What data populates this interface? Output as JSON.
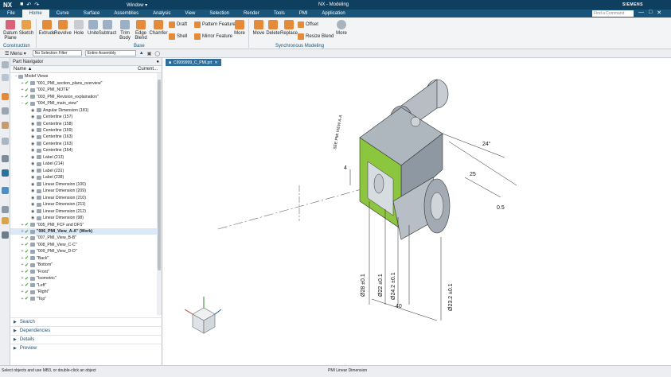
{
  "titlebar": {
    "logo": "NX",
    "window_menu": "Window",
    "title": "NX - Modeling",
    "brand": "SIEMENS",
    "controls": [
      "—",
      "□",
      "✕"
    ]
  },
  "menubar": {
    "tabs": [
      "File",
      "Home",
      "Curve",
      "Surface",
      "Assemblies",
      "Analysis",
      "View",
      "Selection",
      "Render",
      "Tools",
      "PMI",
      "Application"
    ],
    "active_tab": "Home",
    "search_placeholder": "Find a Command"
  },
  "ribbon": {
    "construction": {
      "group_label": "Construction",
      "buttons": [
        "Datum Plane",
        "Sketch"
      ]
    },
    "base": {
      "group_label": "Base",
      "buttons": [
        "Extrude",
        "Revolve",
        "Hole",
        "Unite",
        "Subtract",
        "Trim Body",
        "Edge Blend",
        "Chamfer"
      ],
      "small_buttons": [
        "Draft",
        "Pattern Feature",
        "Shell",
        "Mirror Feature"
      ],
      "more": "More"
    },
    "sync": {
      "group_label": "Synchronous Modeling",
      "buttons": [
        "Move",
        "Delete",
        "Replace"
      ],
      "small_buttons": [
        "Offset",
        "Resize Blend"
      ],
      "more": "More"
    },
    "more_right": "More"
  },
  "toolbar2": {
    "menu_label": "Menu",
    "selection_filter": "No Selection Filter",
    "scope": "Entire Assembly"
  },
  "navigator": {
    "title": "Part Navigator",
    "col_name": "Name",
    "col_current": "Current...",
    "rows": [
      {
        "label": "Model Views",
        "indent": 0,
        "exp": "−",
        "check": false,
        "eye": false
      },
      {
        "label": "\"001_PMI_section_plans_overview\"",
        "indent": 1,
        "exp": "+",
        "check": true,
        "eye": false
      },
      {
        "label": "\"002_PMI_NOTE\"",
        "indent": 1,
        "exp": "+",
        "check": true,
        "eye": false
      },
      {
        "label": "\"003_PMI_Revision_explaination\"",
        "indent": 1,
        "exp": "+",
        "check": true,
        "eye": false
      },
      {
        "label": "\"004_PMI_main_view\"",
        "indent": 1,
        "exp": "−",
        "check": true,
        "eye": false
      },
      {
        "label": "Angular Dimension (181)",
        "indent": 2,
        "exp": "",
        "check": false,
        "eye": true
      },
      {
        "label": "Centerline (157)",
        "indent": 2,
        "exp": "",
        "check": false,
        "eye": true
      },
      {
        "label": "Centerline (158)",
        "indent": 2,
        "exp": "",
        "check": false,
        "eye": true
      },
      {
        "label": "Centerline (159)",
        "indent": 2,
        "exp": "",
        "check": false,
        "eye": true
      },
      {
        "label": "Centerline (163)",
        "indent": 2,
        "exp": "",
        "check": false,
        "eye": true
      },
      {
        "label": "Centerline (163)",
        "indent": 2,
        "exp": "",
        "check": false,
        "eye": true
      },
      {
        "label": "Centerline (164)",
        "indent": 2,
        "exp": "",
        "check": false,
        "eye": true
      },
      {
        "label": "Label (213)",
        "indent": 2,
        "exp": "",
        "check": false,
        "eye": true
      },
      {
        "label": "Label (214)",
        "indent": 2,
        "exp": "",
        "check": false,
        "eye": true
      },
      {
        "label": "Label (231)",
        "indent": 2,
        "exp": "",
        "check": false,
        "eye": true
      },
      {
        "label": "Label (238)",
        "indent": 2,
        "exp": "",
        "check": false,
        "eye": true
      },
      {
        "label": "Linear Dimension (100)",
        "indent": 2,
        "exp": "",
        "check": false,
        "eye": true
      },
      {
        "label": "Linear Dimension (209)",
        "indent": 2,
        "exp": "",
        "check": false,
        "eye": true
      },
      {
        "label": "Linear Dimension (210)",
        "indent": 2,
        "exp": "",
        "check": false,
        "eye": true
      },
      {
        "label": "Linear Dimension (211)",
        "indent": 2,
        "exp": "",
        "check": false,
        "eye": true
      },
      {
        "label": "Linear Dimension (212)",
        "indent": 2,
        "exp": "",
        "check": false,
        "eye": true
      },
      {
        "label": "Linear Dimension (98)",
        "indent": 2,
        "exp": "",
        "check": false,
        "eye": true
      },
      {
        "label": "\"005_PMI_FCF and DFS\"",
        "indent": 1,
        "exp": "+",
        "check": true,
        "eye": false
      },
      {
        "label": "\"006_PMI_View_A-A\" (Work)",
        "indent": 1,
        "exp": "+",
        "check": true,
        "eye": false,
        "bold": true
      },
      {
        "label": "\"007_PMI_View_B-B\"",
        "indent": 1,
        "exp": "+",
        "check": true,
        "eye": false
      },
      {
        "label": "\"008_PMI_View_C-C\"",
        "indent": 1,
        "exp": "+",
        "check": true,
        "eye": false
      },
      {
        "label": "\"009_PMI_View_D-D\"",
        "indent": 1,
        "exp": "+",
        "check": true,
        "eye": false
      },
      {
        "label": "\"Back\"",
        "indent": 1,
        "exp": "+",
        "check": true,
        "eye": false
      },
      {
        "label": "\"Bottom\"",
        "indent": 1,
        "exp": "+",
        "check": true,
        "eye": false
      },
      {
        "label": "\"Front\"",
        "indent": 1,
        "exp": "+",
        "check": true,
        "eye": false
      },
      {
        "label": "\"Isometric\"",
        "indent": 1,
        "exp": "+",
        "check": true,
        "eye": false
      },
      {
        "label": "\"Left\"",
        "indent": 1,
        "exp": "+",
        "check": true,
        "eye": false
      },
      {
        "label": "\"Right\"",
        "indent": 1,
        "exp": "+",
        "check": true,
        "eye": false
      },
      {
        "label": "\"Top\"",
        "indent": 1,
        "exp": "+",
        "check": true,
        "eye": false
      }
    ],
    "accordions": [
      "Search",
      "Dependencies",
      "Details",
      "Preview"
    ]
  },
  "viewport": {
    "tab_label": "C9999999_C_PMI.prt",
    "dimensions": {
      "d1": "Ø28 ±0.1",
      "d2": "Ø22 ±0.1",
      "d3": "Ø24.2 ±0.1",
      "d4": "Ø23.2 ±0.1",
      "d5": "40",
      "d6": "25",
      "d7": "24°",
      "d8": "0.5",
      "d9": "4",
      "note": "SEE PMI VIEW A-A"
    }
  },
  "statusbar": {
    "left": "Select objects and use MB3, or double-click an object",
    "right": "PMI Linear Dimension"
  },
  "colors": {
    "title_bg": "#0f3f5e",
    "menu_bg": "#1a5478",
    "green_face": "#8cc63f",
    "check_green": "#3c9a2e"
  }
}
